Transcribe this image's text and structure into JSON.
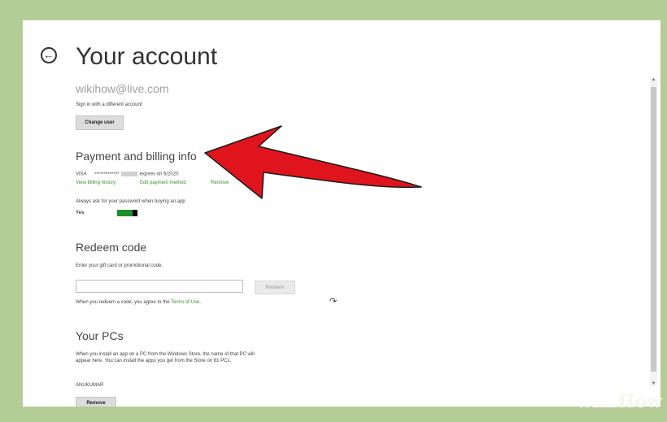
{
  "page": {
    "title": "Your account",
    "email": "wikihow@live.com",
    "sign_in_text": "Sign in with a different account",
    "change_user_label": "Change user"
  },
  "payment": {
    "title": "Payment and billing info",
    "card_brand": "VISA",
    "card_masked": "*************",
    "card_expiry": "expires on 6/2020",
    "links": [
      "View billing history",
      "Edit payment method",
      "Remove"
    ],
    "password_prompt": "Always ask for your password when buying an app",
    "toggle_value": "Yes",
    "toggle_on": true
  },
  "redeem": {
    "title": "Redeem code",
    "instructions": "Enter your gift card or promotional code.",
    "input_value": "",
    "button_label": "Redeem",
    "terms_prefix": "When you redeem a code, you agree to the ",
    "terms_link": "Terms of Use",
    "terms_suffix": "."
  },
  "pcs": {
    "title": "Your PCs",
    "description_line1": "When you install an app on a PC from the Windows Store, the name of that PC will",
    "description_line2": "appear here. You can install the apps you get from the Store on 81 PCs.",
    "pc_name": "ANUKUMAR",
    "remove_label": "Remove"
  },
  "icons": {
    "back": "back-arrow-circle-icon",
    "cursor": "mouse-pointer-icon",
    "annotation": "red-annotation-arrow"
  },
  "watermark": {
    "part1": "wiki",
    "part2": "How"
  },
  "colors": {
    "frame": "#b4cc96",
    "link": "#3b8f2f",
    "toggle": "#1d8e2b",
    "annotation": "#e0141c"
  }
}
